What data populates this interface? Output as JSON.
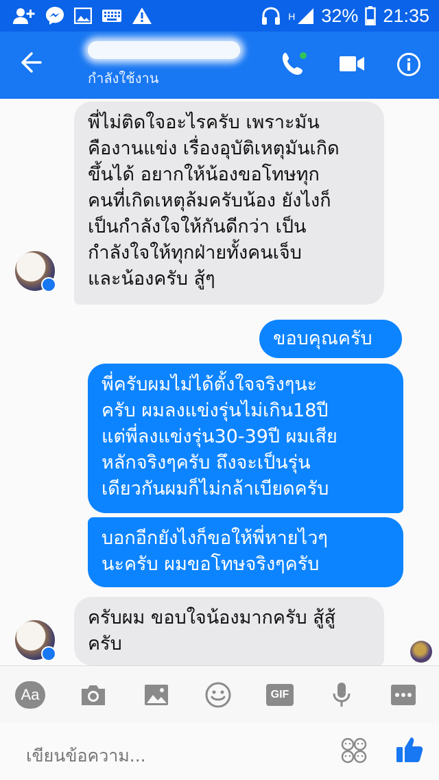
{
  "status_bar": {
    "battery": "32%",
    "time": "21:35",
    "network": "H"
  },
  "header": {
    "contact_status": "กำลังใช้งาน"
  },
  "messages": [
    {
      "dir": "in",
      "text": "พี่ไม่ติดใจอะไรครับ เพราะมัน\nคืองานแข่ง เรื่องอุบัติเหตุมันเกิด\nขึ้นได้ อยากให้น้องขอโทษทุก\nคนที่เกิดเหตุล้มครับน้อง ยังไงก็\nเป็นกำลังใจให้กันดีกว่า เป็น\nกำลังใจให้ทุกฝ่ายทั้งคนเจ็บ\nและน้องครับ สู้ๆ"
    },
    {
      "dir": "out",
      "text": "ขอบคุณครับ"
    },
    {
      "dir": "out",
      "text": "พี่ครับผมไม่ได้ตั้งใจจริงๆนะ\nครับ ผมลงแข่งรุ่นไม่เกิน18ปี\nแต่พี่ลงแข่งรุ่น30-39ปี ผมเสีย\nหลักจริงๆครับ ถึงจะเป็นรุ่น\nเดียวกันผมก็ไม่กล้าเบียดครับ"
    },
    {
      "dir": "out",
      "text": "บอกอีกยังไงก็ขอให้พี่หายไวๆ\nนะครับ ผมขอโทษจริงๆครับ"
    },
    {
      "dir": "in",
      "text": "ครับผม ขอบใจน้องมากครับ สู้สู้\nครับ"
    }
  ],
  "toolbar": {
    "text_label": "Aa",
    "gif_label": "GIF"
  },
  "composer": {
    "placeholder": "เขียนข้อความ..."
  },
  "colors": {
    "status_bar": "#0a63e8",
    "app_bar": "#1877f2",
    "outgoing_bubble": "#0d84ff",
    "incoming_bubble": "#e9e9ec",
    "online_dot": "#31c35b"
  }
}
